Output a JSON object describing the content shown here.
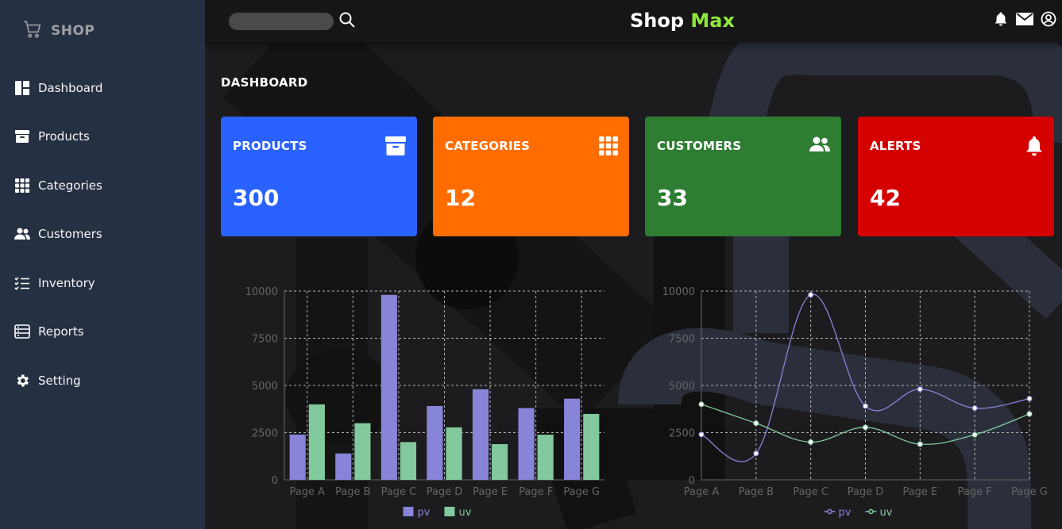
{
  "sidebar": {
    "brand": "SHOP",
    "items": [
      {
        "label": "Dashboard",
        "icon": "dashboard-icon"
      },
      {
        "label": "Products",
        "icon": "archive-icon"
      },
      {
        "label": "Categories",
        "icon": "grid-icon"
      },
      {
        "label": "Customers",
        "icon": "people-icon"
      },
      {
        "label": "Inventory",
        "icon": "list-check-icon"
      },
      {
        "label": "Reports",
        "icon": "report-icon"
      },
      {
        "label": "Setting",
        "icon": "gear-icon"
      }
    ]
  },
  "header": {
    "search_placeholder": "",
    "title_part1": "Shop",
    "title_part2": "Max",
    "title_accent": "#8ee83a"
  },
  "main": {
    "section_title": "DASHBOARD",
    "cards": [
      {
        "title": "PRODUCTS",
        "value": "300",
        "color": "#2962ff",
        "icon": "archive-icon"
      },
      {
        "title": "CATEGORIES",
        "value": "12",
        "color": "#ff6d00",
        "icon": "grid-icon"
      },
      {
        "title": "CUSTOMERS",
        "value": "33",
        "color": "#2e7d32",
        "icon": "people-icon"
      },
      {
        "title": "ALERTS",
        "value": "42",
        "color": "#d50000",
        "icon": "bell-icon"
      }
    ]
  },
  "chart_data": [
    {
      "type": "bar",
      "categories": [
        "Page A",
        "Page B",
        "Page C",
        "Page D",
        "Page E",
        "Page F",
        "Page G"
      ],
      "series": [
        {
          "name": "pv",
          "values": [
            2400,
            1398,
            9800,
            3908,
            4800,
            3800,
            4300
          ],
          "color": "#8884d8"
        },
        {
          "name": "uv",
          "values": [
            4000,
            3000,
            2000,
            2780,
            1890,
            2390,
            3490
          ],
          "color": "#82ca9d"
        }
      ],
      "yticks": [
        "0",
        "2500",
        "5000",
        "7500",
        "10000"
      ],
      "ylim": [
        0,
        10000
      ],
      "grid": true,
      "legend": "bottom"
    },
    {
      "type": "line",
      "categories": [
        "Page A",
        "Page B",
        "Page C",
        "Page D",
        "Page E",
        "Page F",
        "Page G"
      ],
      "series": [
        {
          "name": "pv",
          "values": [
            2400,
            1398,
            9800,
            3908,
            4800,
            3800,
            4300
          ],
          "color": "#8884d8"
        },
        {
          "name": "uv",
          "values": [
            4000,
            3000,
            2000,
            2780,
            1890,
            2390,
            3490
          ],
          "color": "#82ca9d"
        }
      ],
      "yticks": [
        "0",
        "2500",
        "5000",
        "7500",
        "10000"
      ],
      "ylim": [
        0,
        10000
      ],
      "grid": true,
      "legend": "bottom"
    }
  ]
}
